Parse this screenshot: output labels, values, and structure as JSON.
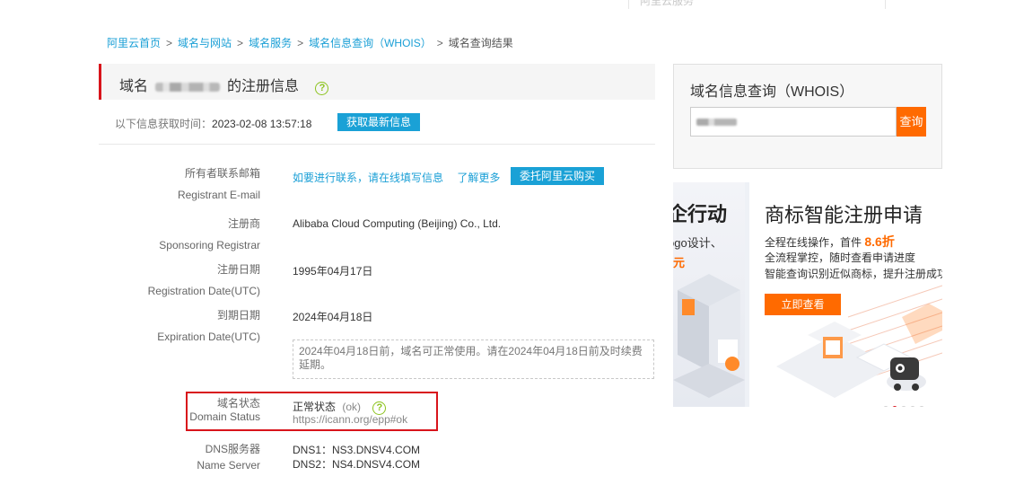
{
  "topbar": {
    "faint_text": "阿里云服务"
  },
  "breadcrumb": {
    "items": [
      "阿里云首页",
      "域名与网站",
      "域名服务",
      "域名信息查询（WHOIS）"
    ],
    "sep": ">",
    "current": "域名查询结果"
  },
  "title": {
    "prefix": "域名",
    "suffix": "的注册信息",
    "help_glyph": "?"
  },
  "fetch": {
    "label": "以下信息获取时间：",
    "time": "2023-02-08 13:57:18",
    "refresh_button": "获取最新信息"
  },
  "registrant_email": {
    "label_cn": "所有者联系邮箱",
    "label_en": "Registrant E-mail",
    "contact_link": "如要进行联系，请在线填写信息",
    "learn_more": "了解更多",
    "entrust_button": "委托阿里云购买"
  },
  "registrar": {
    "label_cn": "注册商",
    "label_en": "Sponsoring Registrar",
    "value": "Alibaba Cloud Computing (Beijing) Co., Ltd."
  },
  "registration_date": {
    "label_cn": "注册日期",
    "label_en": "Registration Date(UTC)",
    "value": "1995年04月17日"
  },
  "expiration_date": {
    "label_cn": "到期日期",
    "label_en": "Expiration Date(UTC)",
    "value": "2024年04月18日",
    "notice": "2024年04月18日前，域名可正常使用。请在2024年04月18日前及时续费延期。"
  },
  "domain_status": {
    "label_cn": "域名状态",
    "label_en": "Domain Status",
    "value_cn": "正常状态",
    "value_code": "(ok)",
    "url": "https://icann.org/epp#ok",
    "highlight_color": "#d8141b"
  },
  "name_server": {
    "label_cn": "DNS服务器",
    "label_en": "Name Server",
    "ns1": "DNS1：NS3.DNSV4.COM",
    "ns2": "DNS2：NS4.DNSV4.COM"
  },
  "whois_panel": {
    "title": "域名信息查询（WHOIS）",
    "query_button": "查询"
  },
  "banner": {
    "left_title": "企行动",
    "left_line": "ogo设计、",
    "left_price": "元",
    "title": "商标智能注册申请",
    "line1_a": "全程在线操作，首件",
    "line1_b": "8.6折",
    "line2": "全流程掌控，随时查看申请进度",
    "line3": "智能查询识别近似商标，提升注册成功率",
    "button": "立即查看"
  },
  "colors": {
    "accent_blue": "#1aa1d6",
    "brand_orange": "#ff6a00",
    "brand_red": "#d8141b",
    "help_green": "#8cc31e"
  }
}
